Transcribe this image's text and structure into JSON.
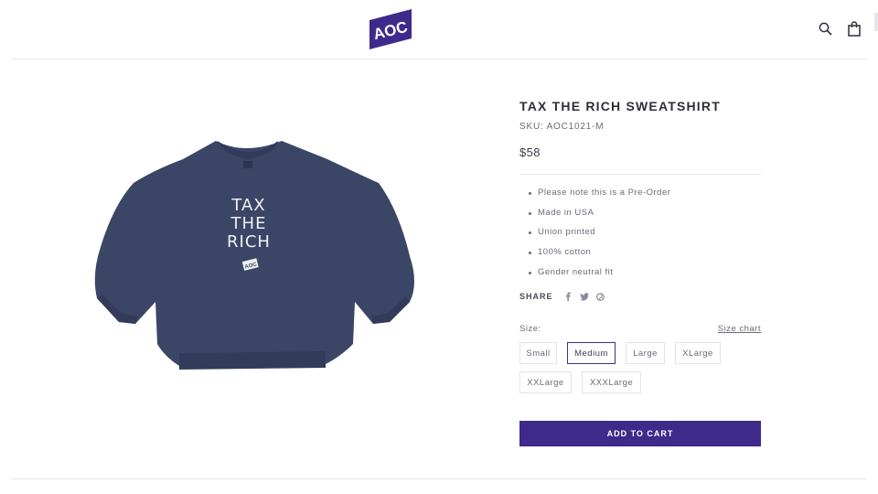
{
  "brand": {
    "logo_text": "AOC",
    "accent_color": "#3d2a8a"
  },
  "header": {
    "icons": [
      "search-icon",
      "bag-icon"
    ]
  },
  "product": {
    "graphic_lines": [
      "TAX",
      "THE",
      "RICH"
    ],
    "graphic_badge": "AOC",
    "garment_color": "#3b4666",
    "title": "TAX THE RICH SWEATSHIRT",
    "sku": "SKU: AOC1021-M",
    "price": "$58",
    "features": [
      "Please note this is a Pre-Order",
      "Made in USA",
      "Union printed",
      "100% cotton",
      "Gender neutral fit"
    ],
    "share": {
      "label": "SHARE",
      "icons": [
        "facebook-icon",
        "twitter-icon",
        "pinterest-icon"
      ]
    },
    "size": {
      "label": "Size:",
      "chart_link": "Size chart",
      "selected": "Medium",
      "options": [
        "Small",
        "Medium",
        "Large",
        "XLarge",
        "XXLarge",
        "XXXLarge"
      ]
    },
    "add_to_cart": "ADD TO CART"
  }
}
